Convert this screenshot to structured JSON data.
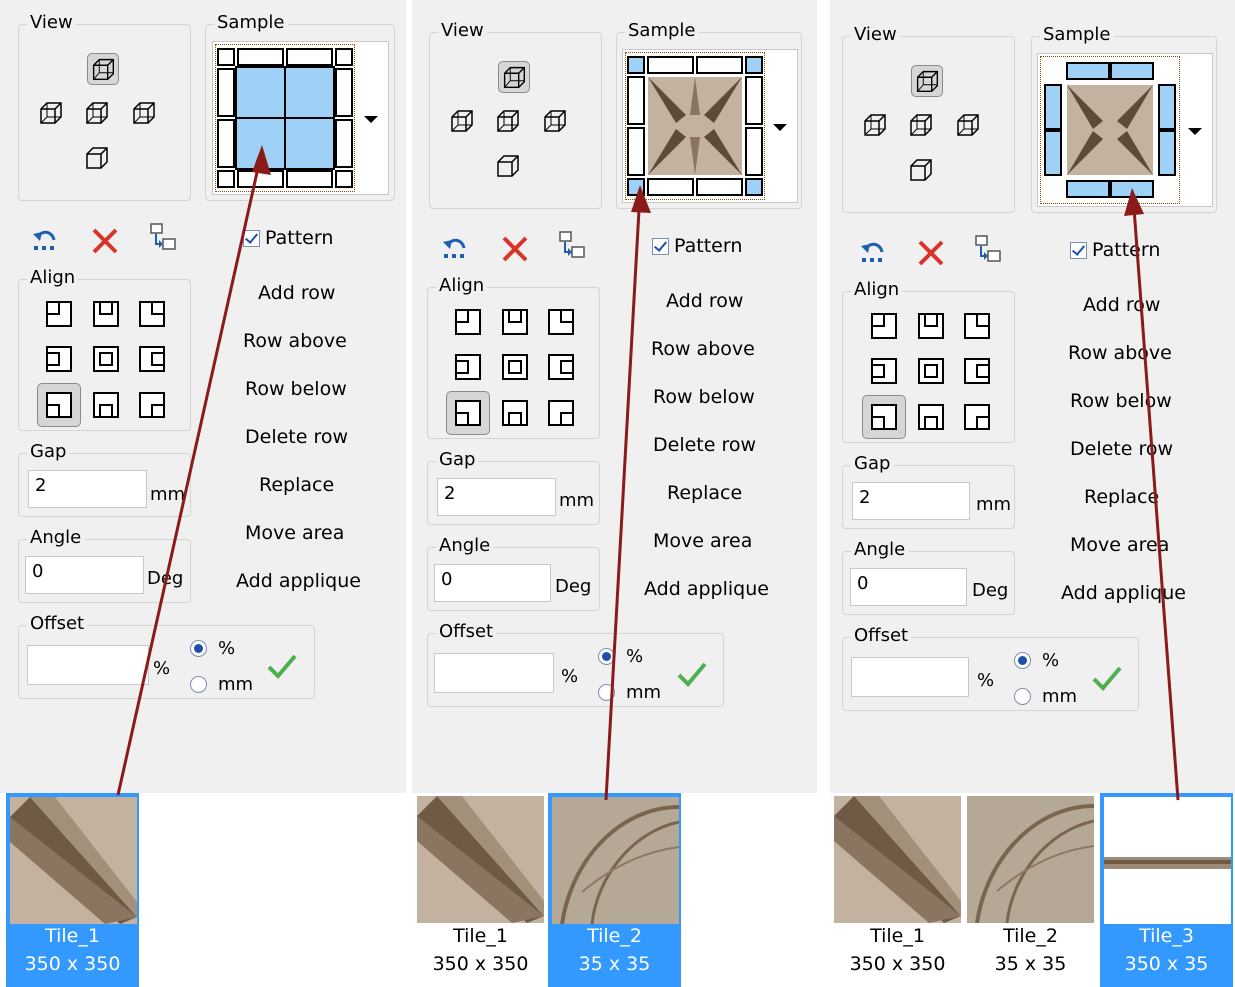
{
  "panels": [
    {
      "view_label": "View",
      "sample_label": "Sample",
      "pattern_label": "Pattern",
      "align_label": "Align",
      "gap_label": "Gap",
      "gap_value": "2",
      "gap_unit": "mm",
      "angle_label": "Angle",
      "angle_value": "0",
      "angle_unit": "Deg",
      "offset_label": "Offset",
      "offset_value": "",
      "offset_unit": "%",
      "radio_pct": "%",
      "radio_mm": "mm",
      "commands": [
        "Add row",
        "Row above",
        "Row below",
        "Delete row",
        "Replace",
        "Move area",
        "Add applique"
      ],
      "tiles": [
        {
          "name": "Tile_1",
          "size": "350 x 350",
          "selected": true
        }
      ]
    },
    {
      "view_label": "View",
      "sample_label": "Sample",
      "pattern_label": "Pattern",
      "align_label": "Align",
      "gap_label": "Gap",
      "gap_value": "2",
      "gap_unit": "mm",
      "angle_label": "Angle",
      "angle_value": "0",
      "angle_unit": "Deg",
      "offset_label": "Offset",
      "offset_value": "",
      "offset_unit": "%",
      "radio_pct": "%",
      "radio_mm": "mm",
      "commands": [
        "Add row",
        "Row above",
        "Row below",
        "Delete row",
        "Replace",
        "Move area",
        "Add applique"
      ],
      "tiles": [
        {
          "name": "Tile_1",
          "size": "350 x 350",
          "selected": false
        },
        {
          "name": "Tile_2",
          "size": "35 x 35",
          "selected": true
        }
      ]
    },
    {
      "view_label": "View",
      "sample_label": "Sample",
      "pattern_label": "Pattern",
      "align_label": "Align",
      "gap_label": "Gap",
      "gap_value": "2",
      "gap_unit": "mm",
      "angle_label": "Angle",
      "angle_value": "0",
      "angle_unit": "Deg",
      "offset_label": "Offset",
      "offset_value": "",
      "offset_unit": "%",
      "radio_pct": "%",
      "radio_mm": "mm",
      "commands": [
        "Add row",
        "Row above",
        "Row below",
        "Delete row",
        "Replace",
        "Move area",
        "Add applique"
      ],
      "tiles": [
        {
          "name": "Tile_1",
          "size": "350 x 350",
          "selected": false
        },
        {
          "name": "Tile_2",
          "size": "35 x 35",
          "selected": false
        },
        {
          "name": "Tile_3",
          "size": "350 x 35",
          "selected": true
        }
      ]
    }
  ],
  "colors": {
    "panel_bg": "#f0f0f0",
    "accent_blue": "#3399ff",
    "sample_blue": "#9fd0f6",
    "arrow": "#8b1a1a",
    "tile_brown": "#b0a08c",
    "check_green": "#4caf50",
    "delete_red": "#d9342b"
  },
  "icons": [
    "cube-view-icon",
    "undo-icon",
    "delete-icon",
    "swap-icon",
    "align-icon",
    "checkmark-icon",
    "arrow-annotation"
  ]
}
